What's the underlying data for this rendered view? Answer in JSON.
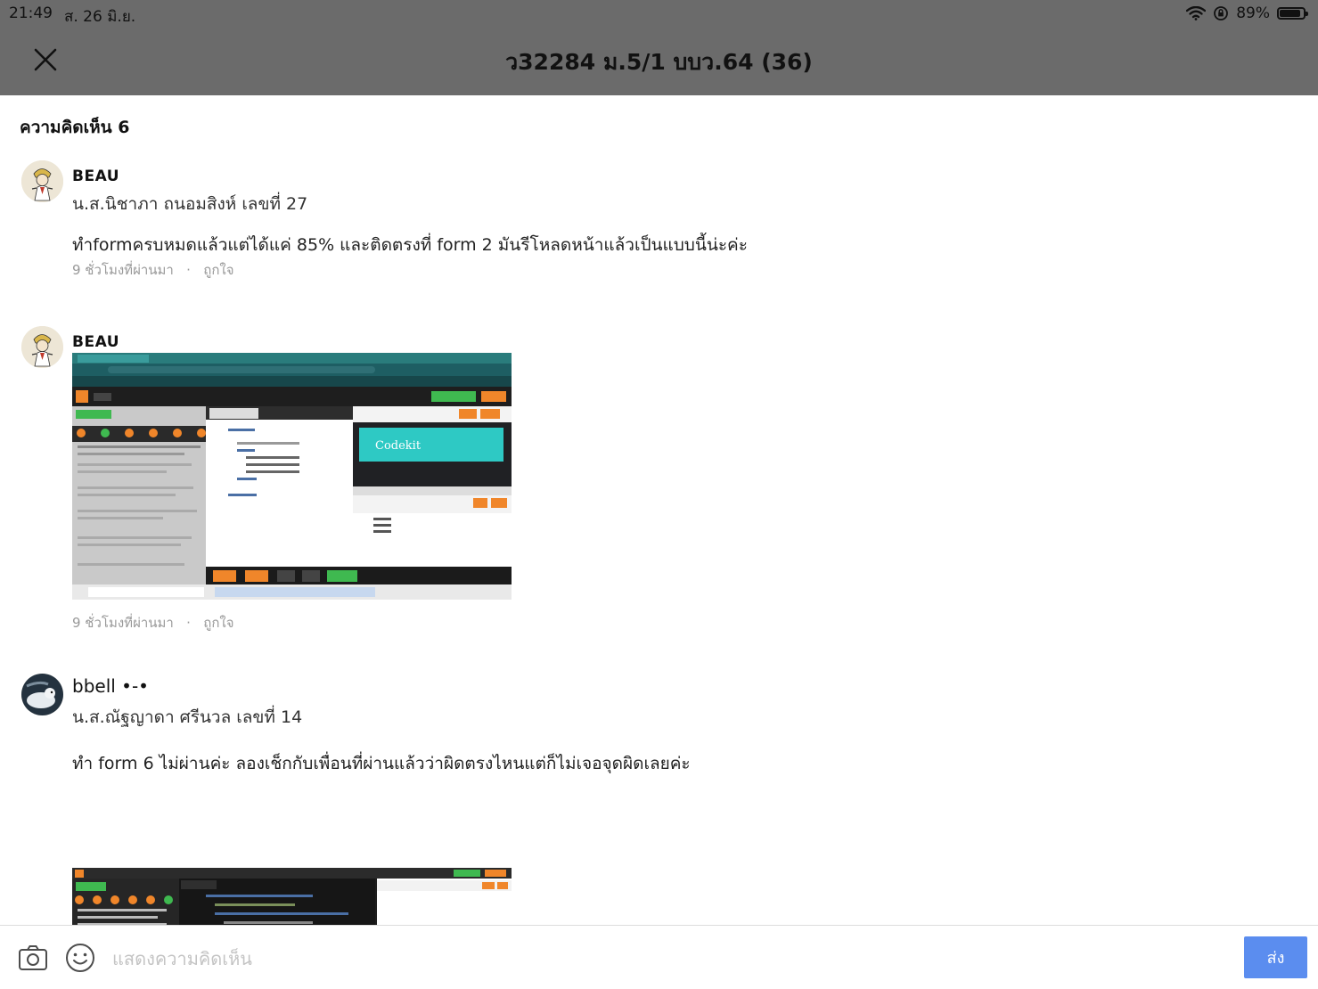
{
  "status_bar": {
    "time": "21:49",
    "date": "ส. 26 มิ.ย.",
    "battery_percent": "89%",
    "battery_level": 0.89
  },
  "header": {
    "title": "ว32284 ม.5/1 บบว.64 (36)"
  },
  "comments_count_label": "ความคิดเห็น 6",
  "comments": [
    {
      "author": "BEAU",
      "full_name": "น.ส.นิชาภา ถนอมสิงห์ เลขที่ 27",
      "text": "ทำformครบหมดแล้วแต่ได้แค่ 85% และติดตรงที่ form 2 มันรีโหลดหน้าแล้วเป็นแบบนี้น่ะค่ะ",
      "time": "9 ชั่วโมงที่ผ่านมา",
      "like_label": "ถูกใจ"
    },
    {
      "author": "BEAU",
      "time": "9 ชั่วโมงที่ผ่านมา",
      "like_label": "ถูกใจ",
      "screenshot_caption": "Codekit"
    },
    {
      "author": "bbell •-•",
      "full_name": "น.ส.ณัฐญาดา ศรีนวล เลขที่ 14",
      "text": "ทำ form 6 ไม่ผ่านค่ะ ลองเช็กกับเพื่อนที่ผ่านแล้วว่าผิดตรงไหนแต่ก็ไม่เจอจุดผิดเลยค่ะ"
    }
  ],
  "composer": {
    "placeholder": "แสดงความคิดเห็น",
    "send_label": "ส่ง"
  },
  "icons": {
    "close": "close-icon",
    "camera": "camera-icon",
    "emoji": "emoji-icon",
    "wifi": "wifi-icon",
    "lock": "orientation-lock-icon",
    "battery": "battery-icon"
  },
  "colors": {
    "header_bg": "#6b6b6b",
    "send_button": "#5b8def",
    "meta_text": "#999999"
  }
}
